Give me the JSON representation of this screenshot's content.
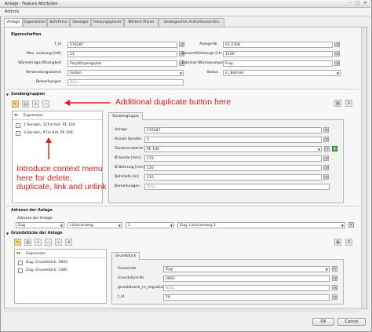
{
  "window": {
    "title": "Anlage - Feature Attributes",
    "min": "–",
    "max": "□",
    "close": "✕"
  },
  "menu": {
    "actions": "Actions"
  },
  "tabs": [
    "Anlage",
    "Eigentümer",
    "Bohrfirma",
    "Geologie",
    "Heizungsplaner",
    "Weitere Planer",
    "Geologisches Aufschlussarchiv"
  ],
  "eigenschaften": {
    "title": "Eigenschaften",
    "t_id_label": "t_id",
    "t_id_value": "576287",
    "max_leistung_label": "Max. Leistung [kW]",
    "max_leistung_value": "23",
    "waermetraeger_label": "Wärmeträger/flüssigkeit",
    "waermetraeger_value": "Polyäthylenglykol",
    "verwendung_label": "Verwendungszweck",
    "verwendung_value": "heizen",
    "bemerkungen_label": "Bemerkungen",
    "bemerkungen_value": "NULL",
    "anlage_nr_label": "Anlage-Nr.",
    "anlage_nr_value": "01.2356",
    "gesamtfuell_label": "Gesamtfüllmenge [Ltr.]",
    "gesamtfuell_value": "1200",
    "fabrikat_label": "Fabrikat Wärmepumpe",
    "fabrikat_value": "Frap",
    "status_label": "Status",
    "status_value": "in_Betrieb"
  },
  "sondengruppen": {
    "title": "Sondengruppen",
    "expression_label": "Expression",
    "items": [
      "2 Sonden, 115m tief, PE 100",
      "3 Sonden, 97m tief, PE 100"
    ],
    "form_title": "Sondengruppe",
    "anlage_label": "Anlage",
    "anlage_value": "576287",
    "anzahl_label": "Anzahl Sonden",
    "anzahl_value": "2",
    "material_label": "Sondenmaterial",
    "material_value": "PE 100",
    "sonde_label": "Ø Sonde [mm]",
    "sonde_value": "115",
    "bohrung_label": "Ø Bohrung [mm]",
    "bohrung_value": "120",
    "bohrtiefe_label": "Bohrtiefe [m]",
    "bohrtiefe_value": "115",
    "bem_label": "Bemerkungen",
    "bem_value": "NULL"
  },
  "adresse": {
    "title": "Adresse der Anlage",
    "sub_label": "Adresse der Anlage",
    "ort": "Zug",
    "strasse": "Lüssirainweg",
    "nr": "1",
    "full": "Zug, Lüssirainweg 1"
  },
  "grundstuecke": {
    "title": "Grundstücke der Anlage",
    "expression_label": "Expression",
    "items": [
      "Zug, Grundstück: 3893",
      "Zug, Grundstück: 1485"
    ],
    "form_title": "Grundstück",
    "gemeinde_label": "Gemeinde",
    "gemeinde_value": "Zug",
    "nr_label": "Grundstück-Nr.",
    "nr_value": "3893",
    "migration_label": "grundstueck_nr_migration",
    "migration_value": "NULL",
    "t_id_label": "t_id",
    "t_id_value": "79"
  },
  "annotations": {
    "dup": "Additional duplicate button here",
    "ctx": "Introduce context menu here for delete, duplicate, link and unlink"
  },
  "buttons": {
    "ok": "OK",
    "cancel": "Cancel"
  },
  "colors": {
    "annotation": "#e0201a",
    "add": "#4aa84a"
  }
}
